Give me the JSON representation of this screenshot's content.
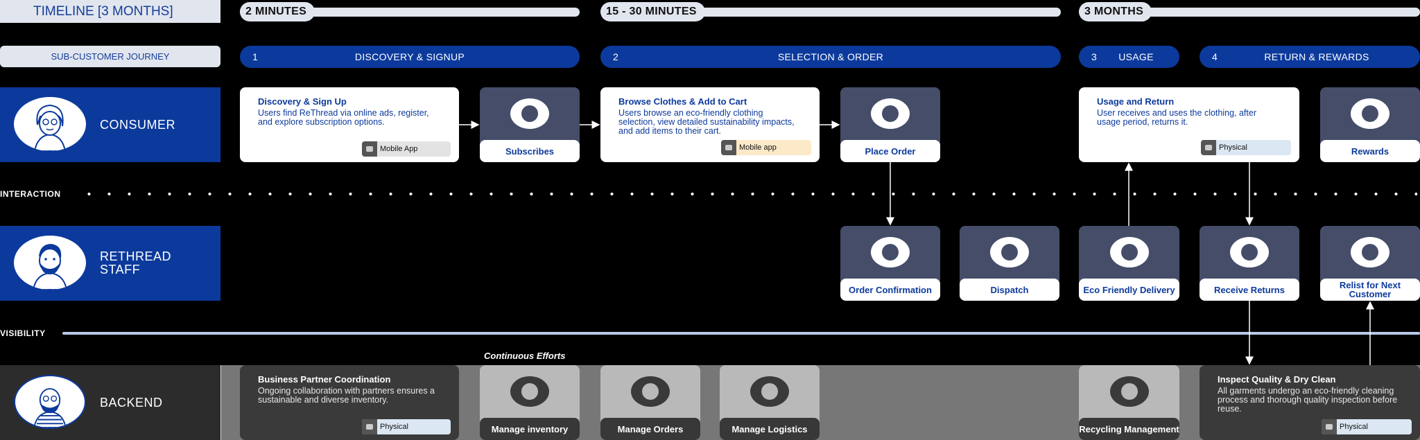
{
  "timeline": {
    "label": "TIMELINE [3 MONTHS]",
    "segments": [
      "2 MINUTES",
      "15 - 30 MINUTES",
      "3 MONTHS"
    ]
  },
  "journey": {
    "label": "SUB-CUSTOMER JOURNEY",
    "stages": [
      {
        "num": "1",
        "name": "DISCOVERY & SIGNUP"
      },
      {
        "num": "2",
        "name": "SELECTION & ORDER"
      },
      {
        "num": "3",
        "name": "USAGE"
      },
      {
        "num": "4",
        "name": "RETURN & REWARDS"
      }
    ]
  },
  "lanes": {
    "consumer": "CONSUMER",
    "staff": "RETHREAD STAFF",
    "backend": "BACKEND"
  },
  "separators": {
    "interaction": "INTERACTION",
    "visibility": "VISIBILITY",
    "continuous": "Continuous Efforts"
  },
  "consumer_cards": [
    {
      "title": "Discovery & Sign Up",
      "body": "Users find ReThread via online ads, register, and explore subscription options.",
      "tag": "Mobile App"
    },
    {
      "title": "Browse Clothes & Add to Cart",
      "body": "Users browse an eco-friendly clothing selection, view detailed sustainability impacts, and add items to their cart.",
      "tag": "Mobile app"
    },
    {
      "title": "Usage and Return",
      "body": "User receives and uses the clothing, after usage period, returns it.",
      "tag": "Physical"
    }
  ],
  "consumer_steps": [
    "Subscribes",
    "Place Order",
    "Rewards"
  ],
  "staff_steps": [
    "Order Confirmation",
    "Dispatch",
    "Eco Friendly Delivery",
    "Receive Returns",
    "Relist for Next Customer"
  ],
  "backend_cards": [
    {
      "title": "Business Partner Coordination",
      "body": "Ongoing collaboration with partners ensures a sustainable and diverse inventory.",
      "tag": "Physical"
    },
    {
      "title": "Inspect Quality & Dry Clean",
      "body": "All garments undergo an eco-friendly cleaning process and thorough quality inspection before reuse.",
      "tag": "Physical"
    }
  ],
  "backend_steps": [
    "Manage inventory",
    "Manage Orders",
    "Manage Logistics",
    "Recycling Management"
  ],
  "colors": {
    "brand": "#0c3a9c",
    "step": "#454d69",
    "light": "#e1e5ee"
  }
}
